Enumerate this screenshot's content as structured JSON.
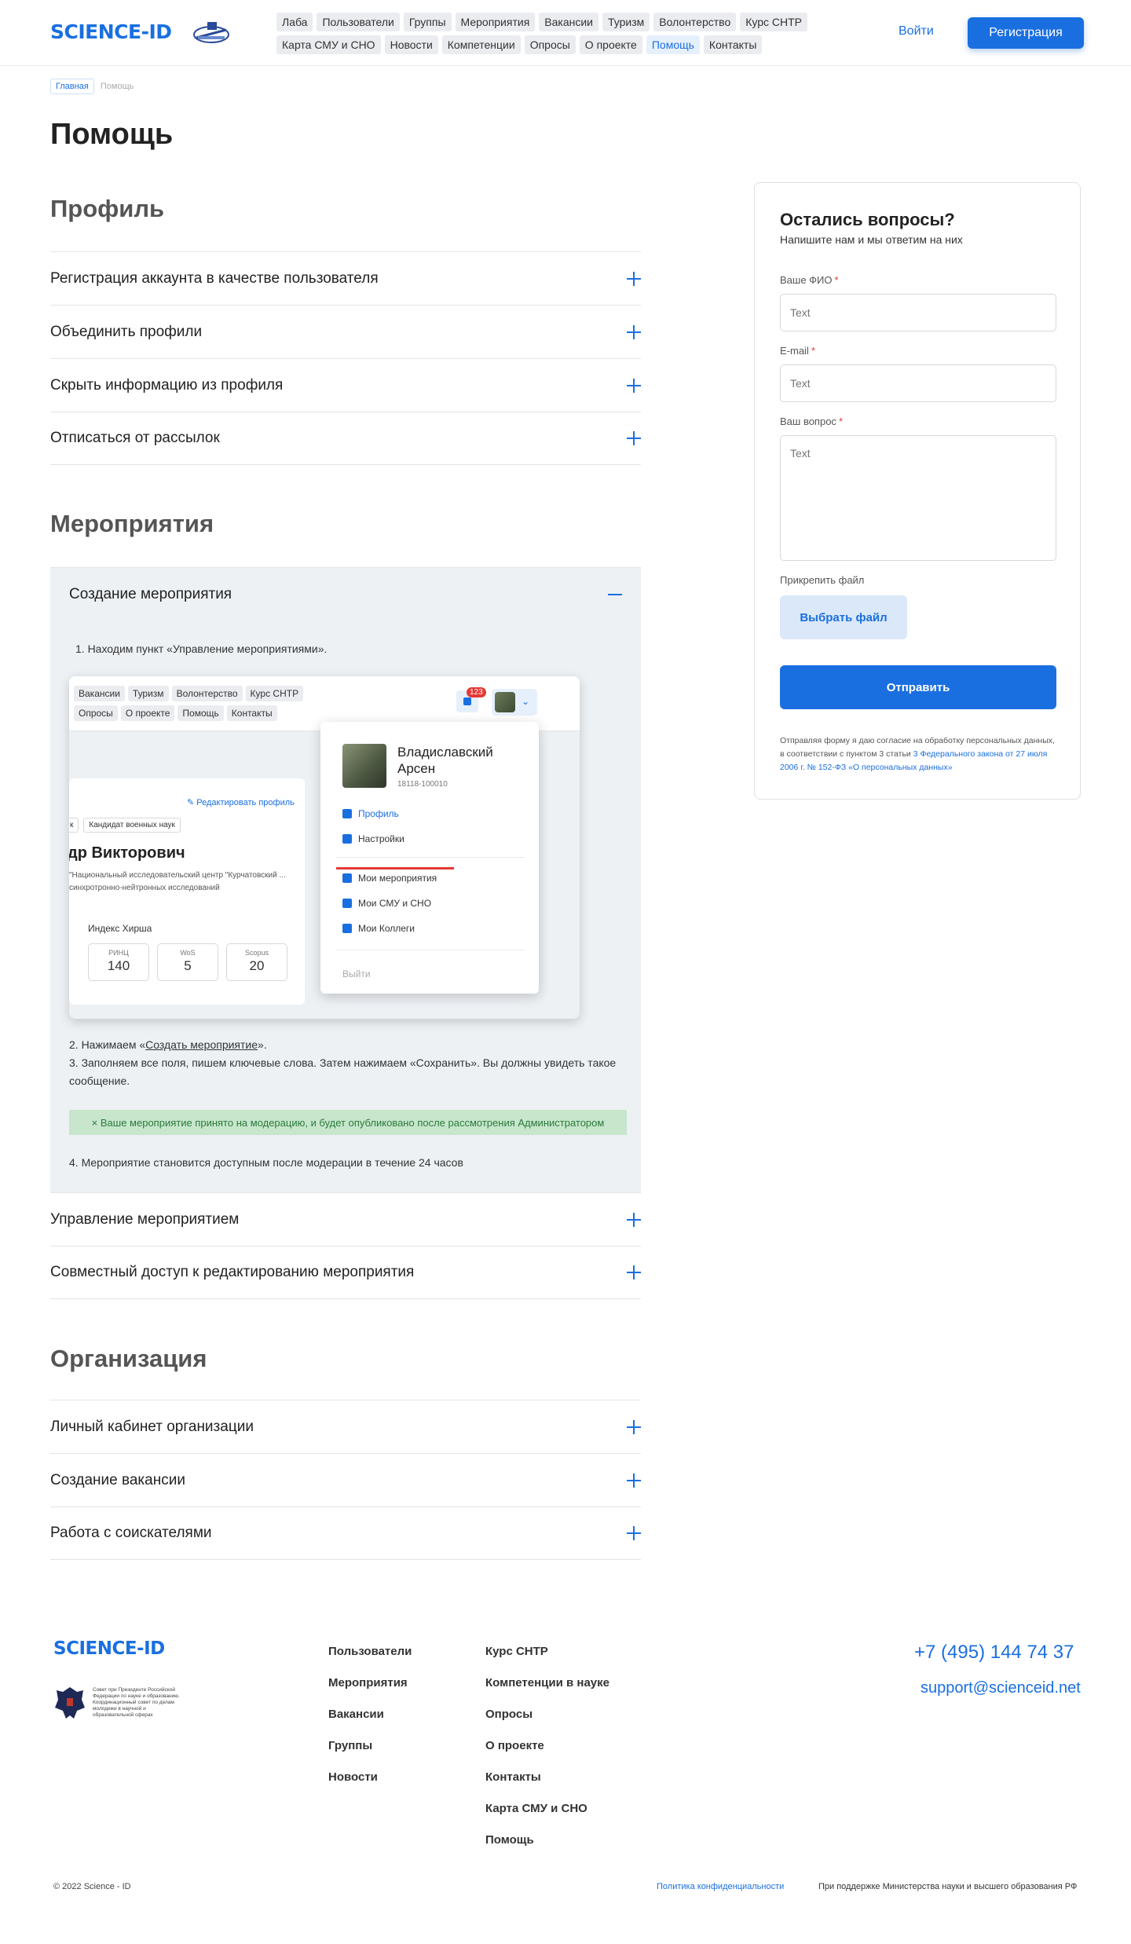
{
  "header": {
    "logo": "SCIENCE-ID",
    "nav_row1": [
      "Лаба",
      "Пользователи",
      "Группы",
      "Мероприятия",
      "Вакансии",
      "Туризм",
      "Волонтерство",
      "Курс СНТР"
    ],
    "nav_row2": [
      "Карта СМУ и СНО",
      "Новости",
      "Компетенции",
      "Опросы",
      "О проекте",
      "Помощь",
      "Контакты"
    ],
    "active_nav": "Помощь",
    "login": "Войти",
    "register": "Регистрация",
    "emblem_icon": "anniversary-emblem"
  },
  "breadcrumb": {
    "home": "Главная",
    "current": "Помощь"
  },
  "page_title": "Помощь",
  "sections": {
    "profile": {
      "title": "Профиль",
      "items": [
        "Регистрация аккаунта в качестве пользователя",
        "Объединить профили",
        "Скрыть информацию из профиля",
        "Отписаться от рассылок"
      ]
    },
    "events": {
      "title": "Мероприятия",
      "expanded_title": "Создание мероприятия",
      "step1": "1. Находим пункт «Управление мероприятиями».",
      "step2_prefix": "2. Нажимаем «",
      "step2_link": "Создать мероприятие",
      "step2_suffix": "».",
      "step3": "3. Заполняем все поля, пишем ключевые слова. Затем нажимаем «Сохранить». Вы должны увидеть такое сообщение.",
      "success": "× Ваше мероприятие принято на модерацию, и будет опубликовано после рассмотрения Администратором",
      "step4": "4. Мероприятие становится доступным после модерации в течение 24 часов",
      "items": [
        "Управление мероприятием",
        "Совместный доступ к редактированию мероприятия"
      ]
    },
    "organization": {
      "title": "Организация",
      "items": [
        "Личный кабинет организации",
        "Создание вакансии",
        "Работа с соискателями"
      ]
    }
  },
  "screenshot": {
    "nav_row1": [
      "Вакансии",
      "Туризм",
      "Волонтерство",
      "Курс СНТР"
    ],
    "nav_row2": [
      "Опросы",
      "О проекте",
      "Помощь",
      "Контакты"
    ],
    "badge": "123",
    "edit_profile": "Редактировать профиль",
    "tags": [
      "к",
      "Кандидат военных наук"
    ],
    "name": "др Викторович",
    "org": "\"Национальный исследовательский центр \"Курчатовский ... синхротронно-нейтронных исследований",
    "hirsh_title": "Индекс Хирша",
    "indices": [
      {
        "label": "РИНЦ",
        "value": "140"
      },
      {
        "label": "WoS",
        "value": "5"
      },
      {
        "label": "Scopus",
        "value": "20"
      }
    ],
    "menu_name": "Владиславский Арсен",
    "menu_id": "18118-100010",
    "menu_profile": "Профиль",
    "menu_settings": "Настройки",
    "menu_events": "Мои мероприятия",
    "menu_smu": "Мои СМУ и СНО",
    "menu_colleagues": "Мои Коллеги",
    "menu_exit": "Выйти"
  },
  "form": {
    "title": "Остались вопросы?",
    "subtitle": "Напишите нам и мы ответим на них",
    "name_label": "Ваше ФИО",
    "email_label": "E-mail",
    "question_label": "Ваш вопрос",
    "placeholder": "Text",
    "required_mark": "*",
    "attach_label": "Прикрепить файл",
    "choose_file": "Выбрать файл",
    "submit": "Отправить",
    "consent_text": "Отправляя форму я даю согласие на обработку персональных данных, в соответствии с пунктом 3 статьи ",
    "consent_link": "3 Федерального закона от 27 июля 2006 г. № 152-ФЗ «О персональных данных»"
  },
  "footer": {
    "logo": "SCIENCE-ID",
    "council": "Совет при Президенте Российской Федерации по науке и образованию. Координационный совет по делам молодежи в научной и образовательной сферах",
    "col1": [
      "Пользователи",
      "Мероприятия",
      "Вакансии",
      "Группы",
      "Новости"
    ],
    "col2": [
      "Курс СНТР",
      "Компетенции в науке",
      "Опросы",
      "О проекте",
      "Контакты",
      "Карта СМУ и СНО",
      "Помощь"
    ],
    "phone": "+7 (495) 144 74 37",
    "email": "support@scienceid.net",
    "copyright": "© 2022 Science - ID",
    "privacy": "Политика конфиденциальности",
    "support": "При поддержке Министерства науки и высшего образования РФ"
  },
  "colors": {
    "accent": "#1a6fe0",
    "expanded_bg": "#edf1f4",
    "success_bg": "#c7e6cc",
    "required": "#e53935"
  }
}
